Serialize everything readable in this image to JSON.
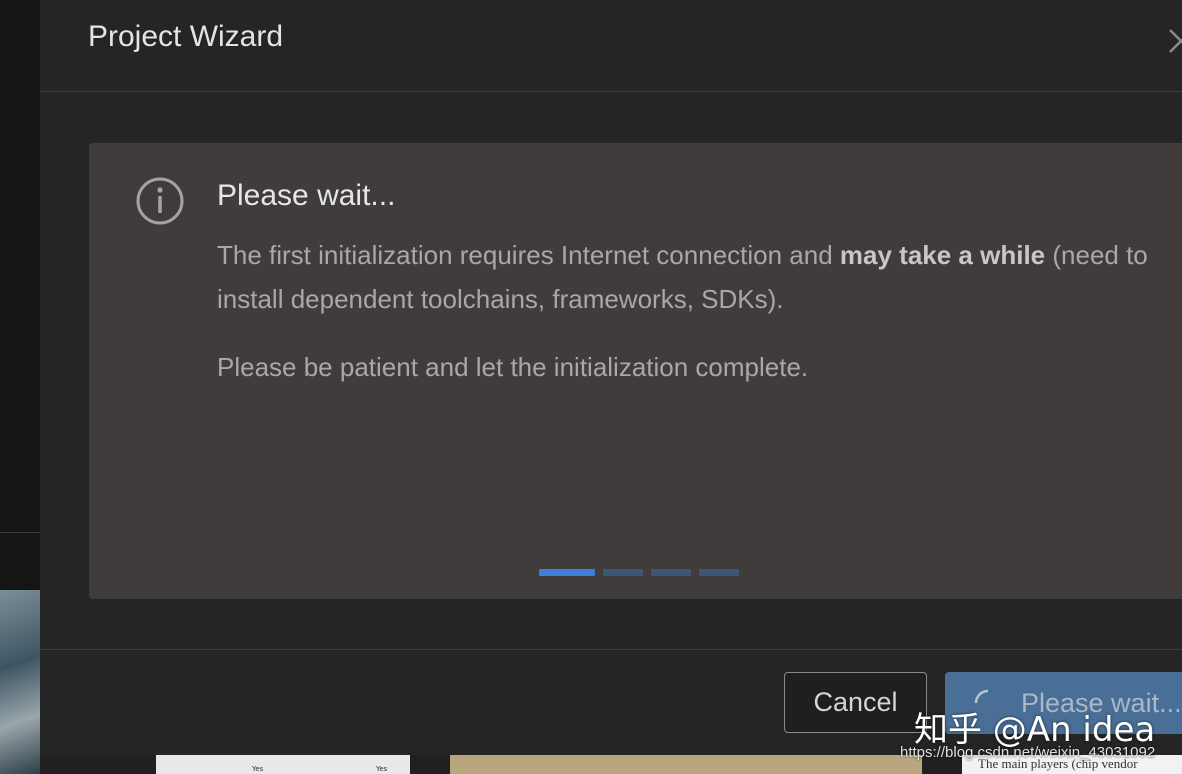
{
  "dialog": {
    "title": "Project Wizard"
  },
  "info": {
    "title": "Please wait...",
    "message_part1": "The first initialization requires Internet connection and ",
    "message_bold": "may take a while",
    "message_part2": " (need to install dependent toolchains, frameworks, SDKs).",
    "message_second": "Please be patient and let the initialization complete.",
    "progress_steps": 4,
    "active_step": 1
  },
  "footer": {
    "cancel_label": "Cancel",
    "primary_label": "Please wait..."
  },
  "background": {
    "partial_text": "The main players (chip vendor",
    "thumb_text_1": "Yes",
    "thumb_text_2": "Yes"
  },
  "watermark": {
    "brand": "知乎 @An idea",
    "url": "https://blog.csdn.net/weixin_43031092"
  },
  "colors": {
    "dialog_bg": "#252525",
    "panel_bg": "#403c3c",
    "accent": "#3d7fd4",
    "primary_button": "#4a6f96"
  },
  "icons": {
    "close": "close-icon",
    "info": "info-icon",
    "spinner": "spinner-icon"
  }
}
